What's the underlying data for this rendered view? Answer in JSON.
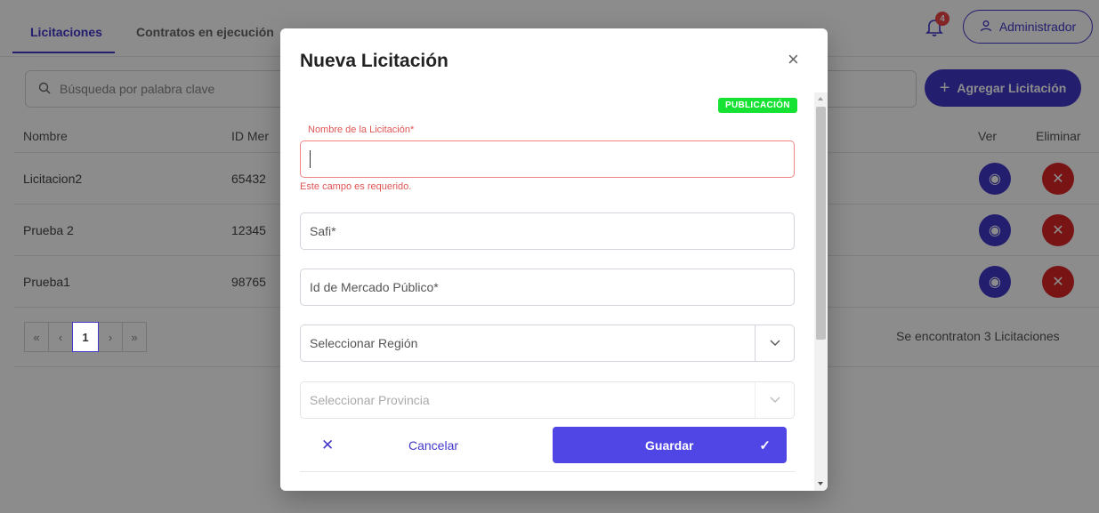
{
  "nav": {
    "tabs": [
      "Licitaciones",
      "Contratos en ejecución",
      "..."
    ],
    "notification_count": "4",
    "admin_label": "Administrador"
  },
  "search": {
    "placeholder": "Búsqueda por palabra clave"
  },
  "add_button_label": "Agregar Licitación",
  "table": {
    "headers": {
      "nombre": "Nombre",
      "id": "ID Mer",
      "ver": "Ver",
      "eliminar": "Eliminar"
    },
    "rows": [
      {
        "nombre": "Licitacion2",
        "id": "65432"
      },
      {
        "nombre": "Prueba 2",
        "id": "12345"
      },
      {
        "nombre": "Prueba1",
        "id": "98765"
      }
    ]
  },
  "pagination": {
    "first": "«",
    "prev": "‹",
    "current": "1",
    "next": "›",
    "last": "»",
    "info": "Se encontraton 3 Licitaciones"
  },
  "modal": {
    "title": "Nueva Licitación",
    "badge": "PUBLICACIÓN",
    "name_label": "Nombre de la Licitación*",
    "name_value": "",
    "name_error": "Este campo es requerido.",
    "safi_placeholder": "Safi*",
    "mercado_placeholder": "Id de Mercado Público*",
    "region_placeholder": "Seleccionar Región",
    "provincia_placeholder": "Seleccionar Provincia",
    "cancel_label": "Cancelar",
    "save_label": "Guardar"
  },
  "colors": {
    "primary": "#4338ca",
    "danger": "#dc2626",
    "badge_green": "#16e233",
    "error": "#e05555"
  }
}
